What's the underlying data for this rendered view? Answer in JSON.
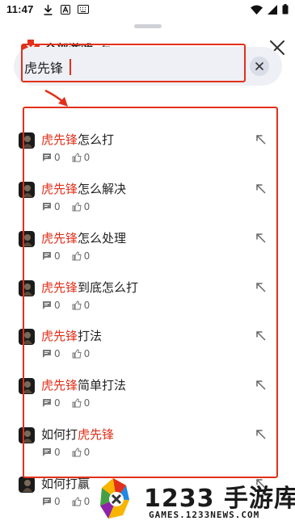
{
  "status_bar": {
    "time": "11:47",
    "icons": [
      "download-icon",
      "a-badge-icon",
      "keyboard-icon",
      "wifi-icon",
      "signal-icon",
      "battery-icon"
    ]
  },
  "header": {
    "title": "全部游戏",
    "swap_icon": "⇆"
  },
  "search": {
    "value": "虎先锋",
    "placeholder": ""
  },
  "colors": {
    "highlight": "#e2301a",
    "annotation": "#e2301a",
    "search_bg": "#eef0f6"
  },
  "results": [
    {
      "highlight": "虎先锋",
      "rest": "怎么打",
      "prefix": "",
      "comments": "0",
      "likes": "0"
    },
    {
      "highlight": "虎先锋",
      "rest": "怎么解决",
      "prefix": "",
      "comments": "0",
      "likes": "0"
    },
    {
      "highlight": "虎先锋",
      "rest": "怎么处理",
      "prefix": "",
      "comments": "0",
      "likes": "0"
    },
    {
      "highlight": "虎先锋",
      "rest": "到底怎么打",
      "prefix": "",
      "comments": "0",
      "likes": "0"
    },
    {
      "highlight": "虎先锋",
      "rest": "打法",
      "prefix": "",
      "comments": "0",
      "likes": "0"
    },
    {
      "highlight": "虎先锋",
      "rest": "简单打法",
      "prefix": "",
      "comments": "0",
      "likes": "0"
    },
    {
      "highlight": "虎先锋",
      "rest": "",
      "prefix": "如何打",
      "comments": "0",
      "likes": "0"
    },
    {
      "highlight": "",
      "rest": "",
      "prefix": "如何打赢",
      "comments": "0",
      "likes": "0"
    }
  ],
  "watermark": {
    "big": "1233 手游库",
    "small": "GAMES.1233NEWS.COM"
  }
}
